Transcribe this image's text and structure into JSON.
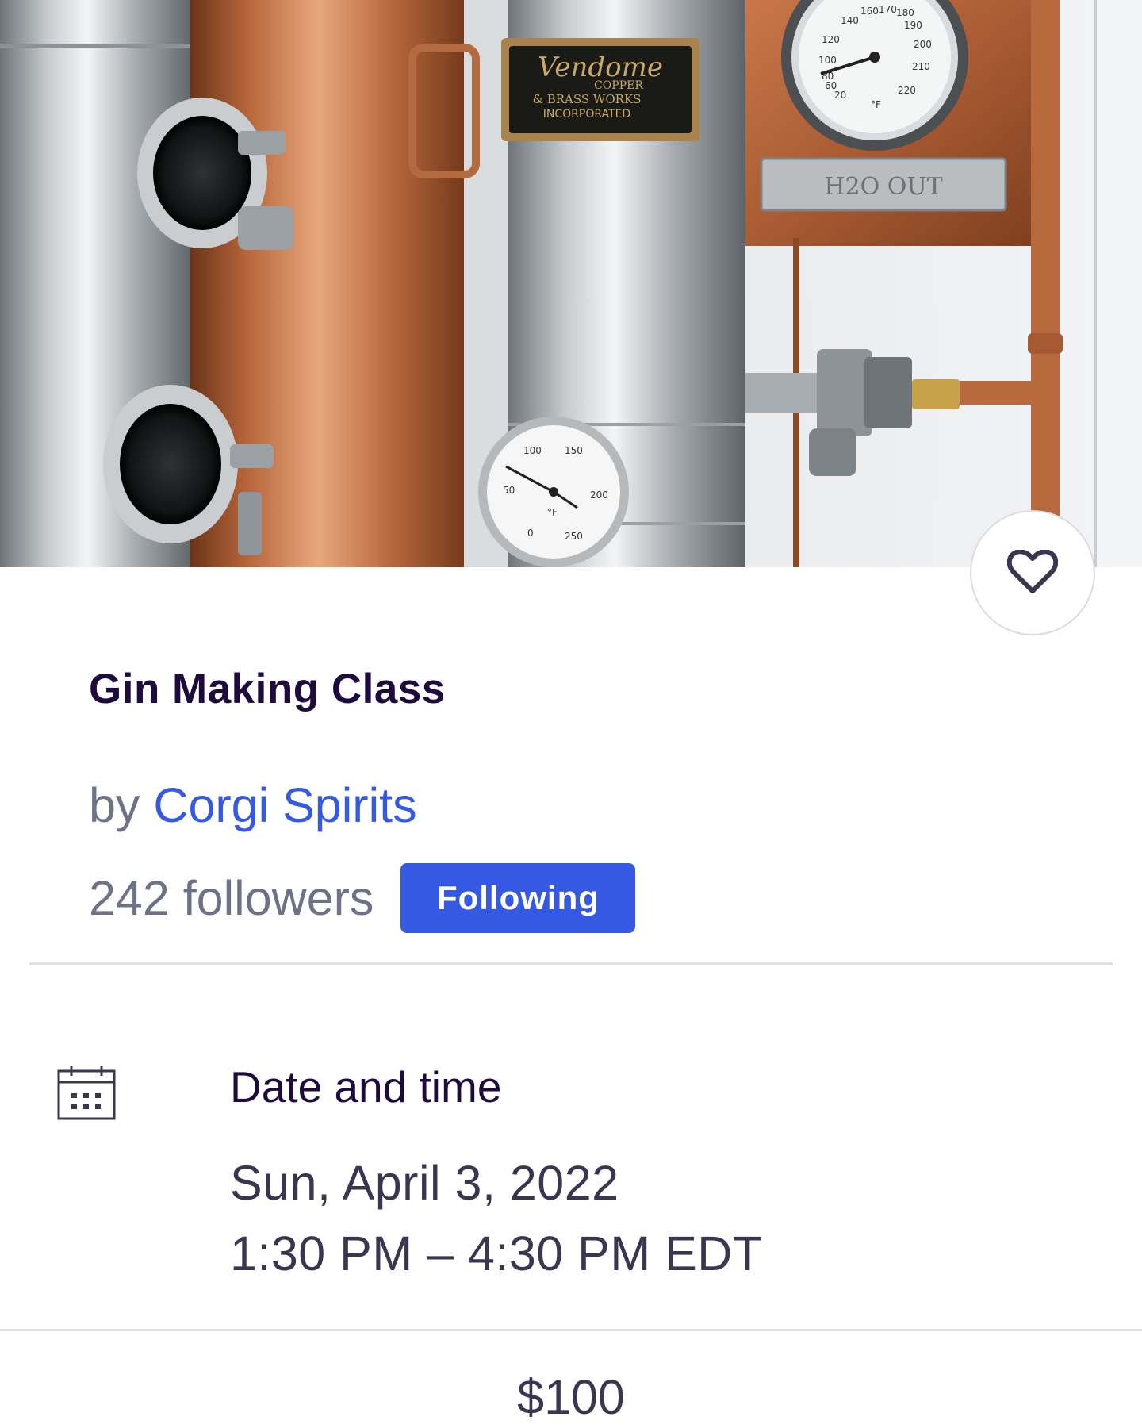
{
  "event": {
    "title": "Gin Making Class",
    "by_prefix": "by",
    "organizer_name": "Corgi Spirits",
    "followers_text": "242 followers",
    "follow_button_label": "Following",
    "favorited": false
  },
  "hero_photo": {
    "plate_lines": [
      "Vendome",
      "COPPER",
      "& BRASS WORKS",
      "INCORPORATED"
    ],
    "sign_text": "H2O OUT",
    "gauge_top_ticks": [
      "140",
      "160",
      "170",
      "180",
      "190",
      "200",
      "210",
      "220",
      "120",
      "100",
      "80",
      "60",
      "20"
    ],
    "gauge_bottom_ticks": [
      "100",
      "150",
      "200",
      "250",
      "50",
      "0"
    ],
    "unit": "°F"
  },
  "date_time": {
    "heading": "Date and time",
    "date": "Sun, April 3, 2022",
    "time": "1:30 PM – 4:30 PM EDT"
  },
  "price": "$100",
  "icons": {
    "favorite": "heart-outline-icon",
    "calendar": "calendar-icon"
  },
  "colors": {
    "brand_blue": "#3659e3",
    "title_text": "#1e0a3c",
    "muted_text": "#6f7287",
    "body_text": "#39364f",
    "divider": "#e1e2e8"
  }
}
